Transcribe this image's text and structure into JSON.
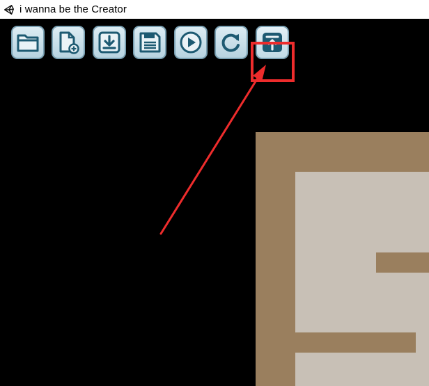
{
  "window": {
    "title": "i wanna be the Creator",
    "app_icon": "unity-icon"
  },
  "toolbar": {
    "buttons": [
      {
        "name": "open-folder-button",
        "icon": "folder-icon"
      },
      {
        "name": "new-file-button",
        "icon": "new-file-icon"
      },
      {
        "name": "download-button",
        "icon": "download-icon"
      },
      {
        "name": "save-button",
        "icon": "floppy-disk-icon"
      },
      {
        "name": "play-button",
        "icon": "play-icon"
      },
      {
        "name": "reload-button",
        "icon": "refresh-icon"
      },
      {
        "name": "upload-button",
        "icon": "upload-icon",
        "highlighted": true
      }
    ]
  },
  "annotation": {
    "highlight_color": "#ee2c2c",
    "target": "upload-button"
  },
  "colors": {
    "button_face": "#c5dde8",
    "button_border": "#7ba1b3",
    "icon_dark": "#1d5a72",
    "wall": "#9a7f5e",
    "floor": "#c8c0b6",
    "background": "#000000"
  }
}
